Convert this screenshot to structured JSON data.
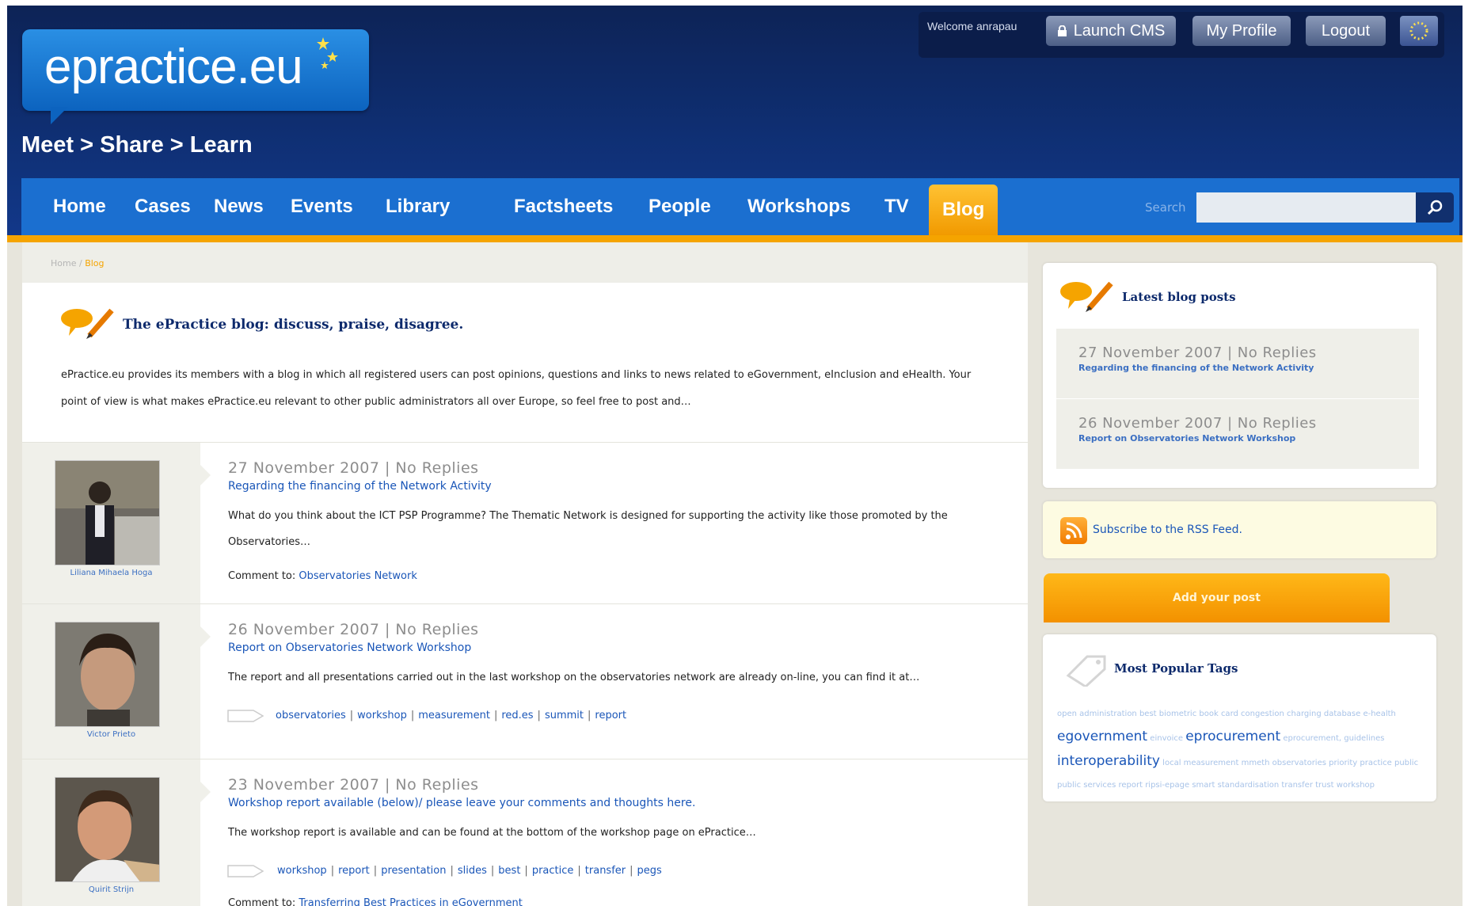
{
  "header": {
    "logo": "epractice.eu",
    "tagline": "Meet > Share > Learn",
    "welcome": "Welcome anrapau",
    "buttons": {
      "launch_cms": "Launch CMS",
      "my_profile": "My Profile",
      "logout": "Logout"
    }
  },
  "nav": {
    "items": [
      "Home",
      "Cases",
      "News",
      "Events",
      "Library",
      "Factsheets",
      "People",
      "Workshops",
      "TV",
      "Blog"
    ],
    "active": "Blog",
    "search_label": "Search",
    "search_value": ""
  },
  "breadcrumb": {
    "home": "Home",
    "sep": "/",
    "current": "Blog"
  },
  "intro": {
    "title": "The ePractice blog: discuss, praise, disagree.",
    "text": "ePractice.eu provides its members with a blog in which all registered users can post opinions, questions and links to news related to eGovernment, eInclusion and eHealth. Your point of view is what makes ePractice.eu relevant to other public administrators all over Europe, so feel free to post and…"
  },
  "posts": [
    {
      "author": "Liliana Mihaela Hoga",
      "date": "27 November 2007 | No Replies",
      "title": "Regarding the financing of the Network Activity",
      "text": "What do you think about the ICT PSP Programme? The Thematic Network is designed for supporting the activity like those promoted by the Observatories…",
      "comment_label": "Comment to:",
      "comment_link": "Observatories Network"
    },
    {
      "author": "Victor Prieto",
      "date": "26 November 2007 | No Replies",
      "title": "Report on Observatories Network Workshop",
      "text": "The report and all presentations carried out in the last workshop on the observatories network are already on-line, you can find it at…",
      "tags": [
        "observatories",
        "workshop",
        "measurement",
        "red.es",
        "summit",
        "report"
      ]
    },
    {
      "author": "Quirit Strijn",
      "date": "23 November 2007 | No Replies",
      "title": "Workshop report available (below)/ please leave your comments and thoughts here.",
      "text": "The workshop report is available and can be found at the bottom of the workshop page on ePractice…",
      "tags": [
        "workshop",
        "report",
        "presentation",
        "slides",
        "best",
        "practice",
        "transfer",
        "pegs"
      ],
      "comment_label": "Comment to:",
      "comment_link": "Transferring Best Practices in eGovernment"
    }
  ],
  "sidebar": {
    "latest_title": "Latest blog posts",
    "latest": [
      {
        "date": "27 November 2007 | No Replies",
        "title": "Regarding the financing of the Network Activity"
      },
      {
        "date": "26 November 2007 | No Replies",
        "title": "Report on Observatories Network Workshop"
      }
    ],
    "rss": "Subscribe to the RSS Feed.",
    "add_post": "Add your post",
    "tags_title": "Most Popular Tags",
    "tag_cloud_small1": "open administration best biometric book card congestion charging database e-health",
    "tag_big1": "egovernment",
    "tag_small2": "einvoice",
    "tag_big2": "eprocurement",
    "tag_small3": "eprocurement, guidelines",
    "tag_big3": "interoperability",
    "tag_small4": "local measurement mmeth observatories priority practice public",
    "tag_cloud_small5": "public services report ripsi-epage smart standardisation transfer trust workshop"
  },
  "colors": {
    "nav": "#1b6fd0",
    "accent": "#f5a400",
    "header": "#0f2f73",
    "link": "#1a56b8"
  }
}
